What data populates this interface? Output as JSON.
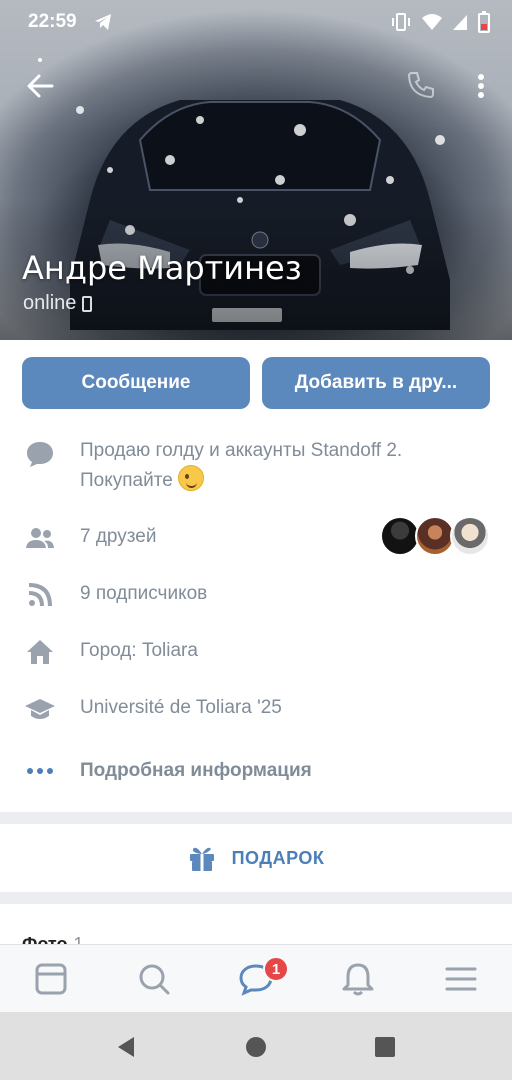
{
  "status_bar": {
    "time": "22:59"
  },
  "profile": {
    "name": "Андре Мартинез",
    "status": "online"
  },
  "actions": {
    "message_label": "Сообщение",
    "add_friend_label": "Добавить в дру..."
  },
  "info": {
    "status_text_line1": "Продаю голду и аккаунты Standoff 2.",
    "status_text_line2": "Покупайте",
    "friends": "7 друзей",
    "followers": "9 подписчиков",
    "city": "Город: Toliara",
    "university": "Université de Toliara '25",
    "details_link": "Подробная информация"
  },
  "gift": {
    "label": "ПОДАРОК"
  },
  "photos": {
    "title": "Фото",
    "count": "1"
  },
  "tabbar": {
    "items": [
      "news-tab",
      "search-tab",
      "messages-tab",
      "notifications-tab",
      "menu-tab"
    ],
    "messages_badge": "1"
  },
  "colors": {
    "accent": "#5b88bd",
    "link": "#4a7fb8",
    "icon_gray": "#99a2ad",
    "badge_red": "#e64646"
  }
}
